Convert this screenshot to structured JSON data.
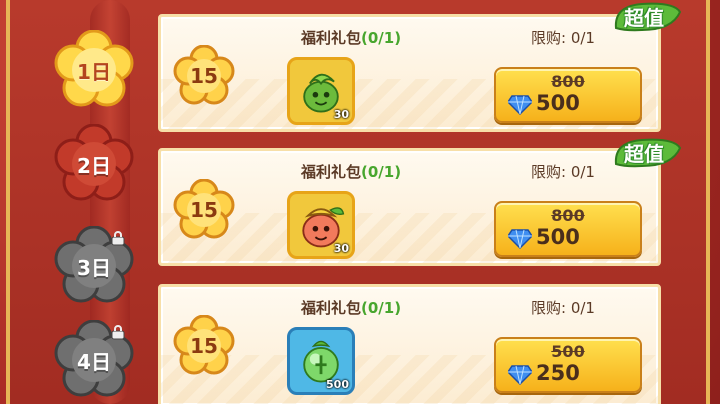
{
  "days": [
    {
      "label": "1日",
      "state": "active"
    },
    {
      "label": "2日",
      "state": "unlocked"
    },
    {
      "label": "3日",
      "state": "locked"
    },
    {
      "label": "4日",
      "state": "locked"
    }
  ],
  "cards": [
    {
      "badge": "15",
      "title": "福利礼包",
      "count": "(0/1)",
      "limit": "限购: 0/1",
      "item_qty": "30",
      "item_icon": "green-sprout-cookie-icon",
      "old_price": "800",
      "new_price": "500",
      "tag": "超值",
      "item_bg": "#f1c83c"
    },
    {
      "badge": "15",
      "title": "福利礼包",
      "count": "(0/1)",
      "limit": "限购: 0/1",
      "item_qty": "30",
      "item_icon": "peach-cookie-icon",
      "old_price": "800",
      "new_price": "500",
      "tag": "超值",
      "item_bg": "#f1c83c"
    },
    {
      "badge": "15",
      "title": "福利礼包",
      "count": "(0/1)",
      "limit": "限购: 0/1",
      "item_qty": "500",
      "item_icon": "green-orb-icon",
      "old_price": "500",
      "new_price": "250",
      "tag": "",
      "item_bg": "#4fb8e6"
    }
  ],
  "colors": {
    "accent": "#f6b11b",
    "frame": "#b8322a",
    "green": "#48a62e"
  }
}
